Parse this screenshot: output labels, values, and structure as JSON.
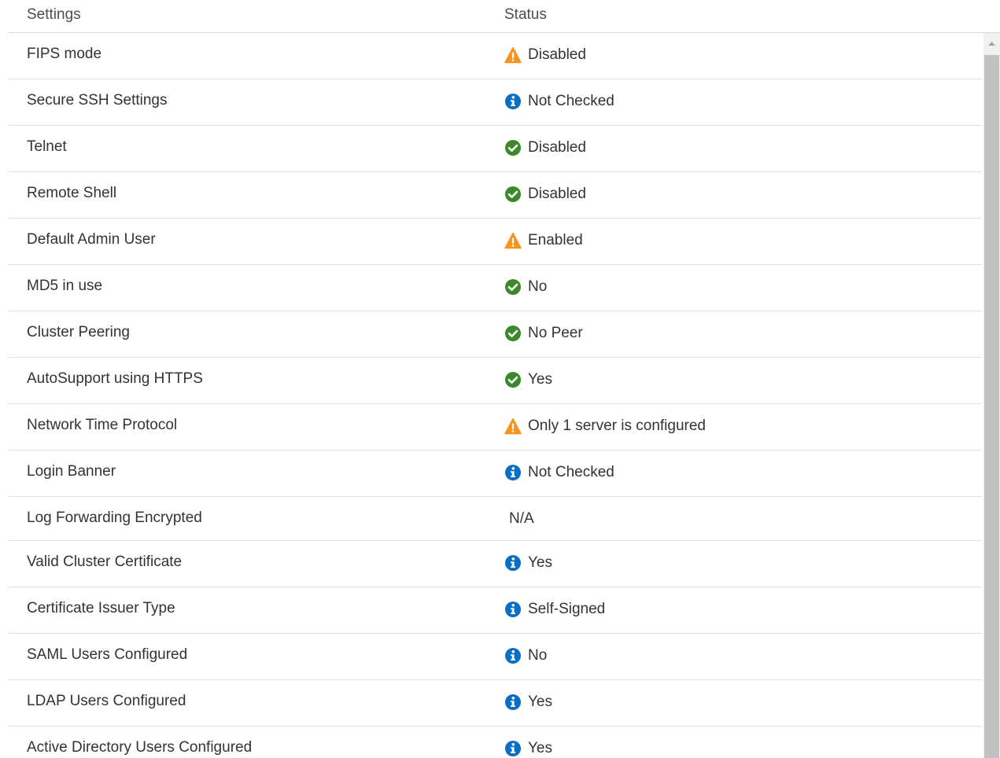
{
  "header": {
    "settings_label": "Settings",
    "status_label": "Status"
  },
  "colors": {
    "warning": "#f7941d",
    "info": "#0b6ec5",
    "ok": "#3a8a2a"
  },
  "rows": [
    {
      "name": "FIPS mode",
      "status": "Disabled",
      "icon": "warning-icon"
    },
    {
      "name": "Secure SSH Settings",
      "status": "Not Checked",
      "icon": "info-icon"
    },
    {
      "name": "Telnet",
      "status": "Disabled",
      "icon": "check-icon"
    },
    {
      "name": "Remote Shell",
      "status": "Disabled",
      "icon": "check-icon"
    },
    {
      "name": "Default Admin User",
      "status": "Enabled",
      "icon": "warning-icon"
    },
    {
      "name": "MD5 in use",
      "status": "No",
      "icon": "check-icon"
    },
    {
      "name": "Cluster Peering",
      "status": "No Peer",
      "icon": "check-icon"
    },
    {
      "name": "AutoSupport using HTTPS",
      "status": "Yes",
      "icon": "check-icon"
    },
    {
      "name": "Network Time Protocol",
      "status": "Only 1 server is configured",
      "icon": "warning-icon"
    },
    {
      "name": "Login Banner",
      "status": "Not Checked",
      "icon": "info-icon"
    },
    {
      "name": "Log Forwarding Encrypted",
      "status": "N/A",
      "icon": ""
    },
    {
      "name": "Valid Cluster Certificate",
      "status": "Yes",
      "icon": "info-icon"
    },
    {
      "name": "Certificate Issuer Type",
      "status": "Self-Signed",
      "icon": "info-icon"
    },
    {
      "name": "SAML Users Configured",
      "status": "No",
      "icon": "info-icon"
    },
    {
      "name": "LDAP Users Configured",
      "status": "Yes",
      "icon": "info-icon"
    },
    {
      "name": "Active Directory Users Configured",
      "status": "Yes",
      "icon": "info-icon"
    }
  ]
}
